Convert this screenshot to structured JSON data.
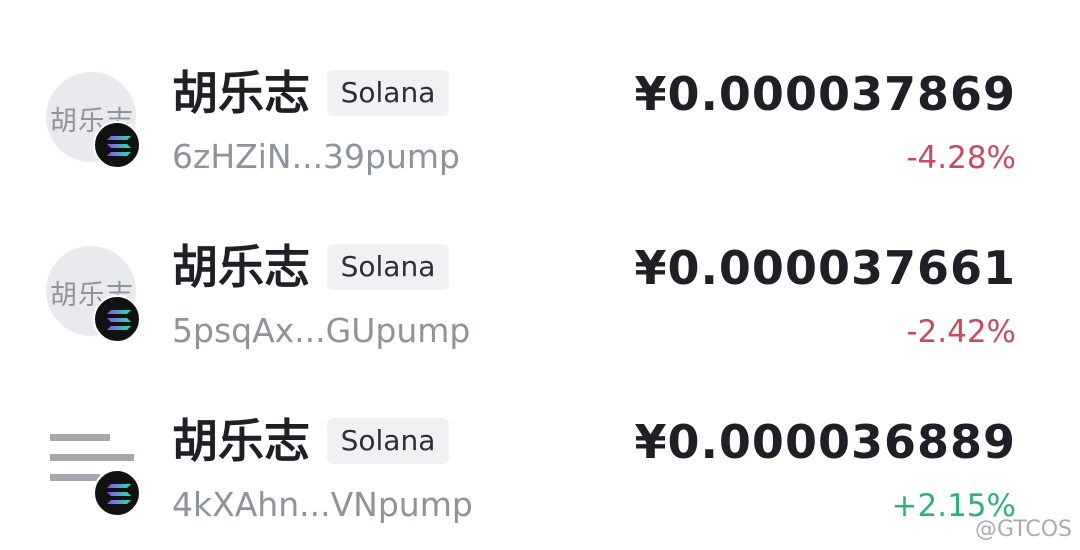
{
  "tokens": [
    {
      "name": "胡乐志",
      "chain": "Solana",
      "address": "6zHZiN...39pump",
      "price": "¥0.000037869",
      "change": "-4.28%",
      "direction": "down",
      "avatar_text": "胡乐志",
      "chain_icon": "solana-icon"
    },
    {
      "name": "胡乐志",
      "chain": "Solana",
      "address": "5psqAx...GUpump",
      "price": "¥0.000037661",
      "change": "-2.42%",
      "direction": "down",
      "avatar_text": "胡乐志",
      "chain_icon": "solana-icon"
    },
    {
      "name": "胡乐志",
      "chain": "Solana",
      "address": "4kXAhn...VNpump",
      "price": "¥0.000036889",
      "change": "+2.15%",
      "direction": "up",
      "chain_icon": "solana-icon"
    }
  ],
  "colors": {
    "negative": "#c94a5e",
    "positive": "#2eb07f",
    "text": "#1e2026",
    "muted": "#8f939b"
  },
  "watermark": "@GTCOS"
}
